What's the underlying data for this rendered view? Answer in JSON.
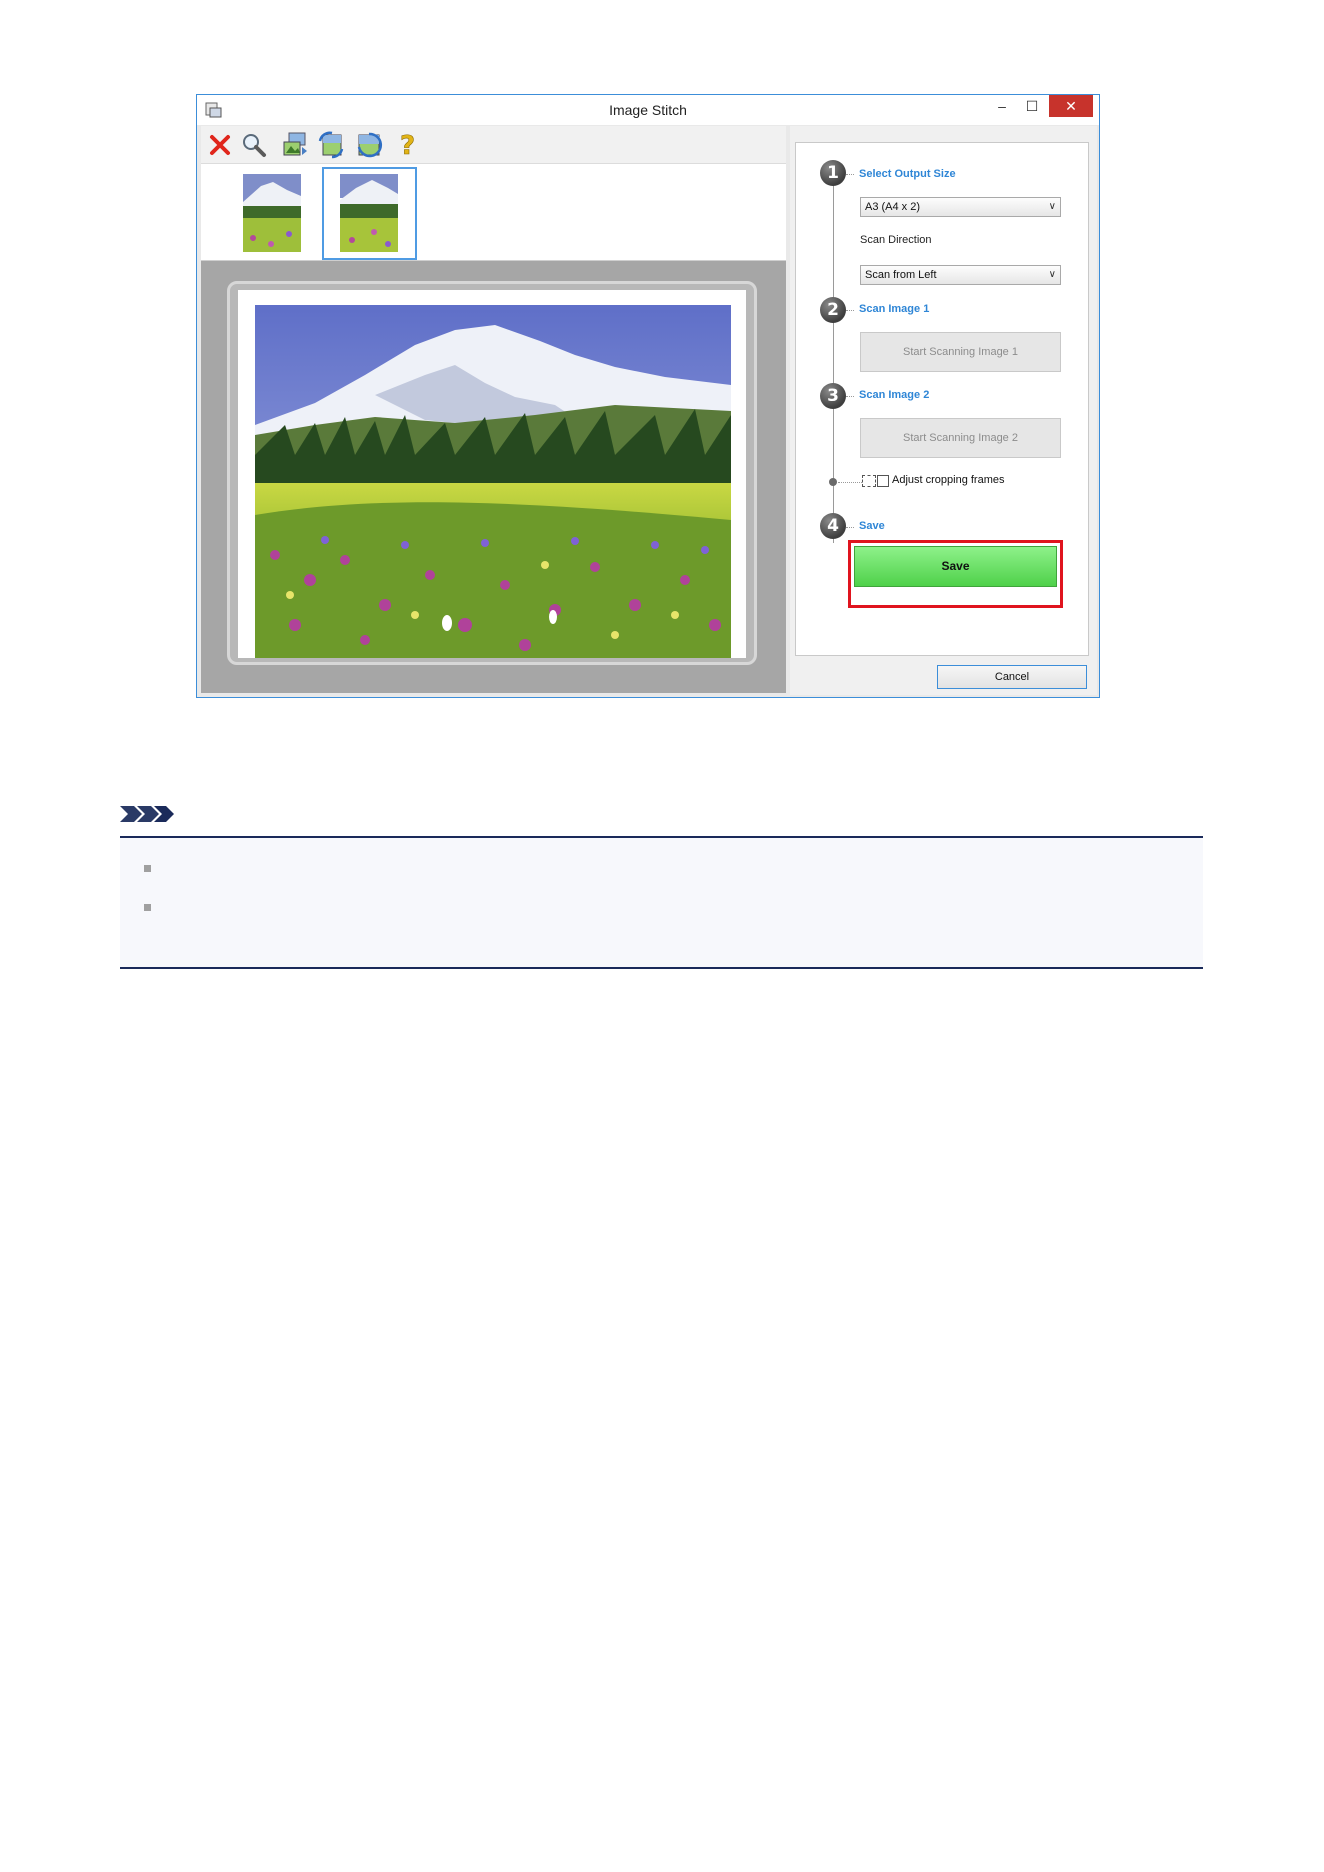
{
  "window": {
    "title": "Image Stitch",
    "controls": {
      "minimize": "–",
      "maximize": "☐",
      "close": "✕"
    }
  },
  "toolbar": {
    "buttons": [
      {
        "name": "delete-icon",
        "color": "#e0261c"
      },
      {
        "name": "zoom-icon"
      },
      {
        "name": "swap-image-icon"
      },
      {
        "name": "rotate-image-icon"
      },
      {
        "name": "flip-image-icon"
      },
      {
        "name": "help-icon",
        "color": "#e2b416"
      }
    ]
  },
  "thumbnails": {
    "count": 2,
    "selected_index": 1
  },
  "steps": [
    {
      "number": "1",
      "title": "Select Output Size"
    },
    {
      "number": "2",
      "title": "Scan Image 1"
    },
    {
      "number": "3",
      "title": "Scan Image 2"
    },
    {
      "number": "4",
      "title": "Save"
    }
  ],
  "output_size": {
    "selected": "A3 (A4 x 2)"
  },
  "scan_direction": {
    "label": "Scan Direction",
    "selected": "Scan from Left"
  },
  "buttons": {
    "scan1": "Start Scanning Image 1",
    "scan2": "Start Scanning Image 2",
    "save": "Save",
    "cancel": "Cancel"
  },
  "adjust_cropping": {
    "label": "Adjust cropping frames",
    "checked": false
  },
  "colors": {
    "accent_blue": "#2f86d6",
    "highlight_red": "#e0141e",
    "save_green": "#5ad455",
    "note_rule": "#1a2a5a"
  }
}
